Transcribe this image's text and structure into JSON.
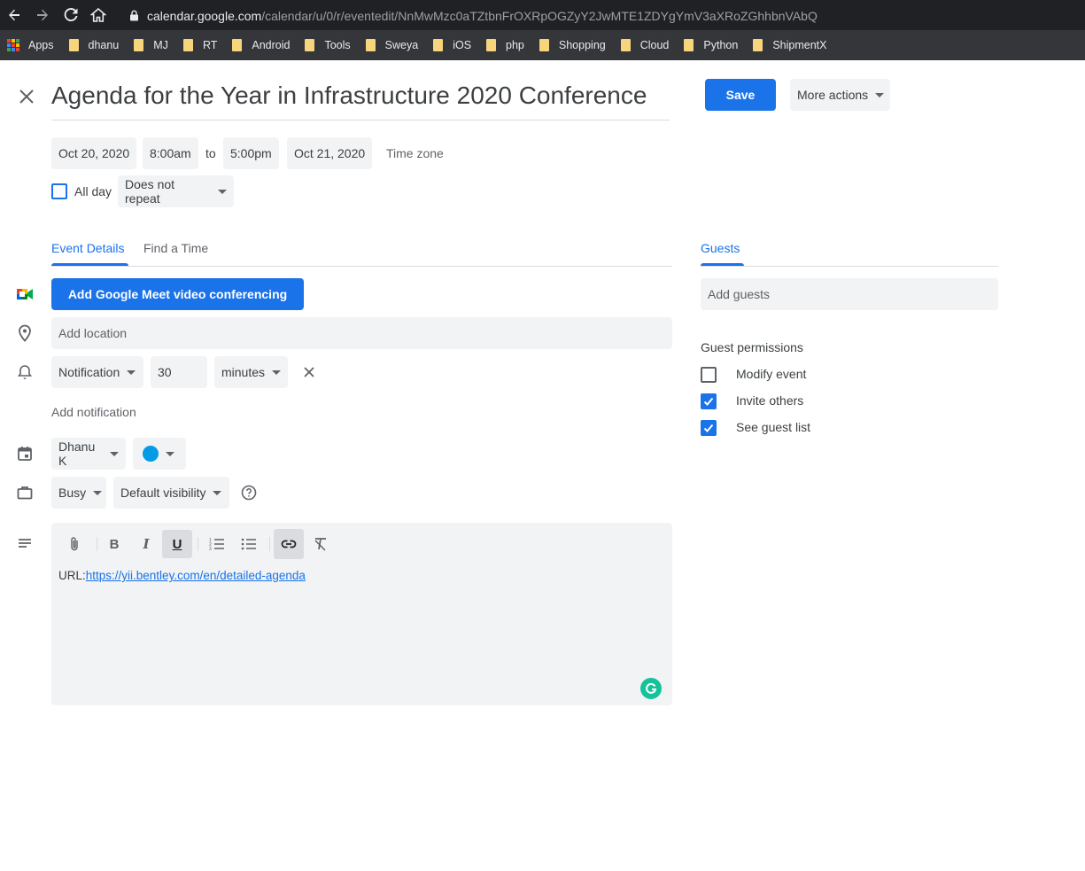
{
  "browser": {
    "url_host": "calendar.google.com",
    "url_path": "/calendar/u/0/r/eventedit/NnMwMzc0aTZtbnFrOXRpOGZyY2JwMTE1ZDYgYmV3aXRoZGhhbnVAbQ",
    "bookmarks": [
      "Apps",
      "dhanu",
      "MJ",
      "RT",
      "Android",
      "Tools",
      "Sweya",
      "iOS",
      "php",
      "Shopping",
      "Cloud",
      "Python",
      "ShipmentX"
    ]
  },
  "event": {
    "title": "Agenda for the Year in Infrastructure 2020 Conference",
    "save_label": "Save",
    "more_actions_label": "More actions",
    "start_date": "Oct 20, 2020",
    "start_time": "8:00am",
    "to_label": "to",
    "end_time": "5:00pm",
    "end_date": "Oct 21, 2020",
    "timezone_label": "Time zone",
    "all_day_label": "All day",
    "repeat_label": "Does not repeat"
  },
  "tabs": {
    "details_label": "Event Details",
    "find_time_label": "Find a Time",
    "guests_label": "Guests"
  },
  "details": {
    "meet_button_label": "Add Google Meet video conferencing",
    "location_placeholder": "Add location",
    "notification_type": "Notification",
    "notification_value": "30",
    "notification_unit": "minutes",
    "add_notification_label": "Add notification",
    "calendar_owner": "Dhanu K",
    "event_color": "#039be5",
    "availability": "Busy",
    "visibility": "Default visibility",
    "description_prefix": "URL:",
    "description_link": "https://yii.bentley.com/en/detailed-agenda"
  },
  "guests": {
    "add_guests_placeholder": "Add guests",
    "permissions_title": "Guest permissions",
    "permissions": [
      {
        "label": "Modify event",
        "checked": false
      },
      {
        "label": "Invite others",
        "checked": true
      },
      {
        "label": "See guest list",
        "checked": true
      }
    ]
  },
  "colors": {
    "accent": "#1a73e8",
    "chrome_dark": "#202124",
    "bookmark_bar": "#35363a",
    "grammarly": "#15c39a"
  }
}
